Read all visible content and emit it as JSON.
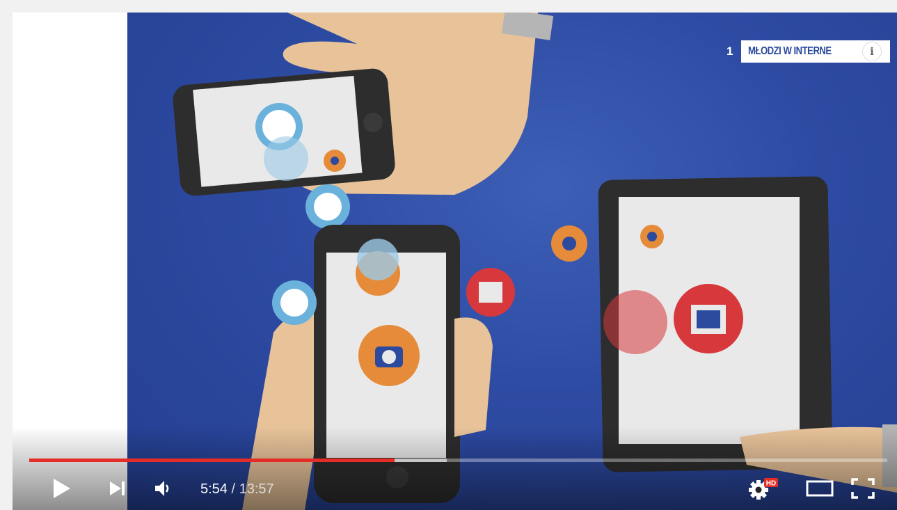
{
  "video": {
    "overlay_number": "1",
    "overlay_title": "MŁODZI W INTERNE"
  },
  "progress": {
    "played_fraction": 0.4257,
    "loaded_fraction": 0.4867
  },
  "controls": {
    "current_time": "5:54",
    "separator": " / ",
    "duration": "13:57",
    "hd_badge": "HD",
    "icons": {
      "play": "play-icon",
      "next": "next-icon",
      "volume": "volume-icon",
      "settings": "gear-icon",
      "theater": "theater-mode-icon",
      "fullscreen": "fullscreen-icon",
      "info": "info-icon"
    }
  },
  "colors": {
    "played": "#e52d27",
    "background": "#2e4ba3",
    "title_text": "#2c4a9e"
  }
}
